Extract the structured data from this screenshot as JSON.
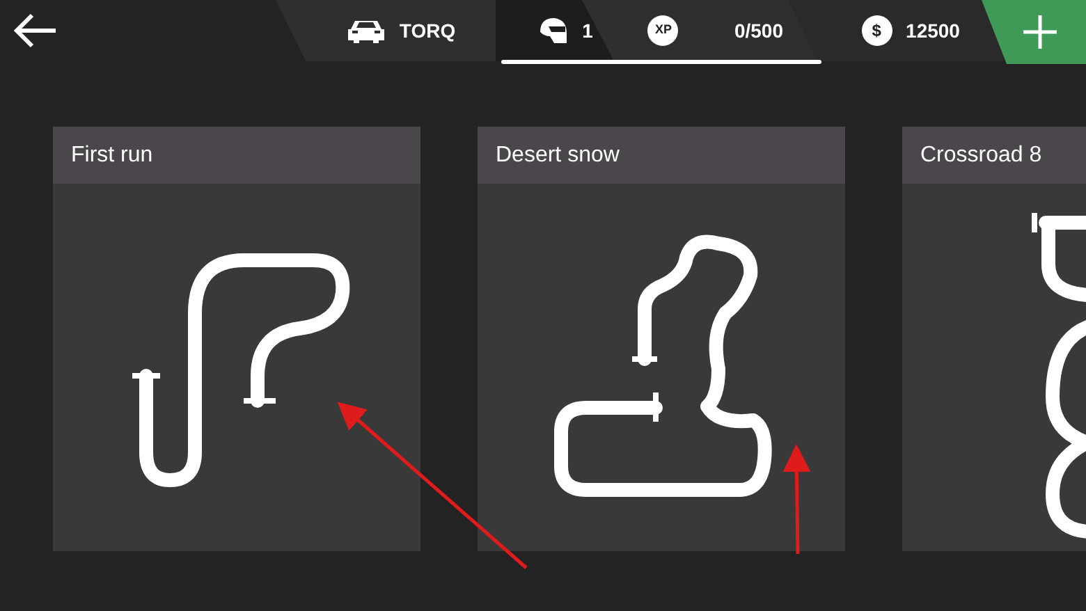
{
  "top_bar": {
    "car": {
      "name": "TORQ"
    },
    "rank": {
      "value": "1"
    },
    "xp": {
      "badge": "XP",
      "value": "0/500"
    },
    "money": {
      "badge": "$",
      "value": "12500"
    }
  },
  "tracks": [
    {
      "name": "First run",
      "kind": "hook"
    },
    {
      "name": "Desert snow",
      "kind": "boot"
    },
    {
      "name": "Crossroad 8",
      "kind": "figure8"
    }
  ]
}
